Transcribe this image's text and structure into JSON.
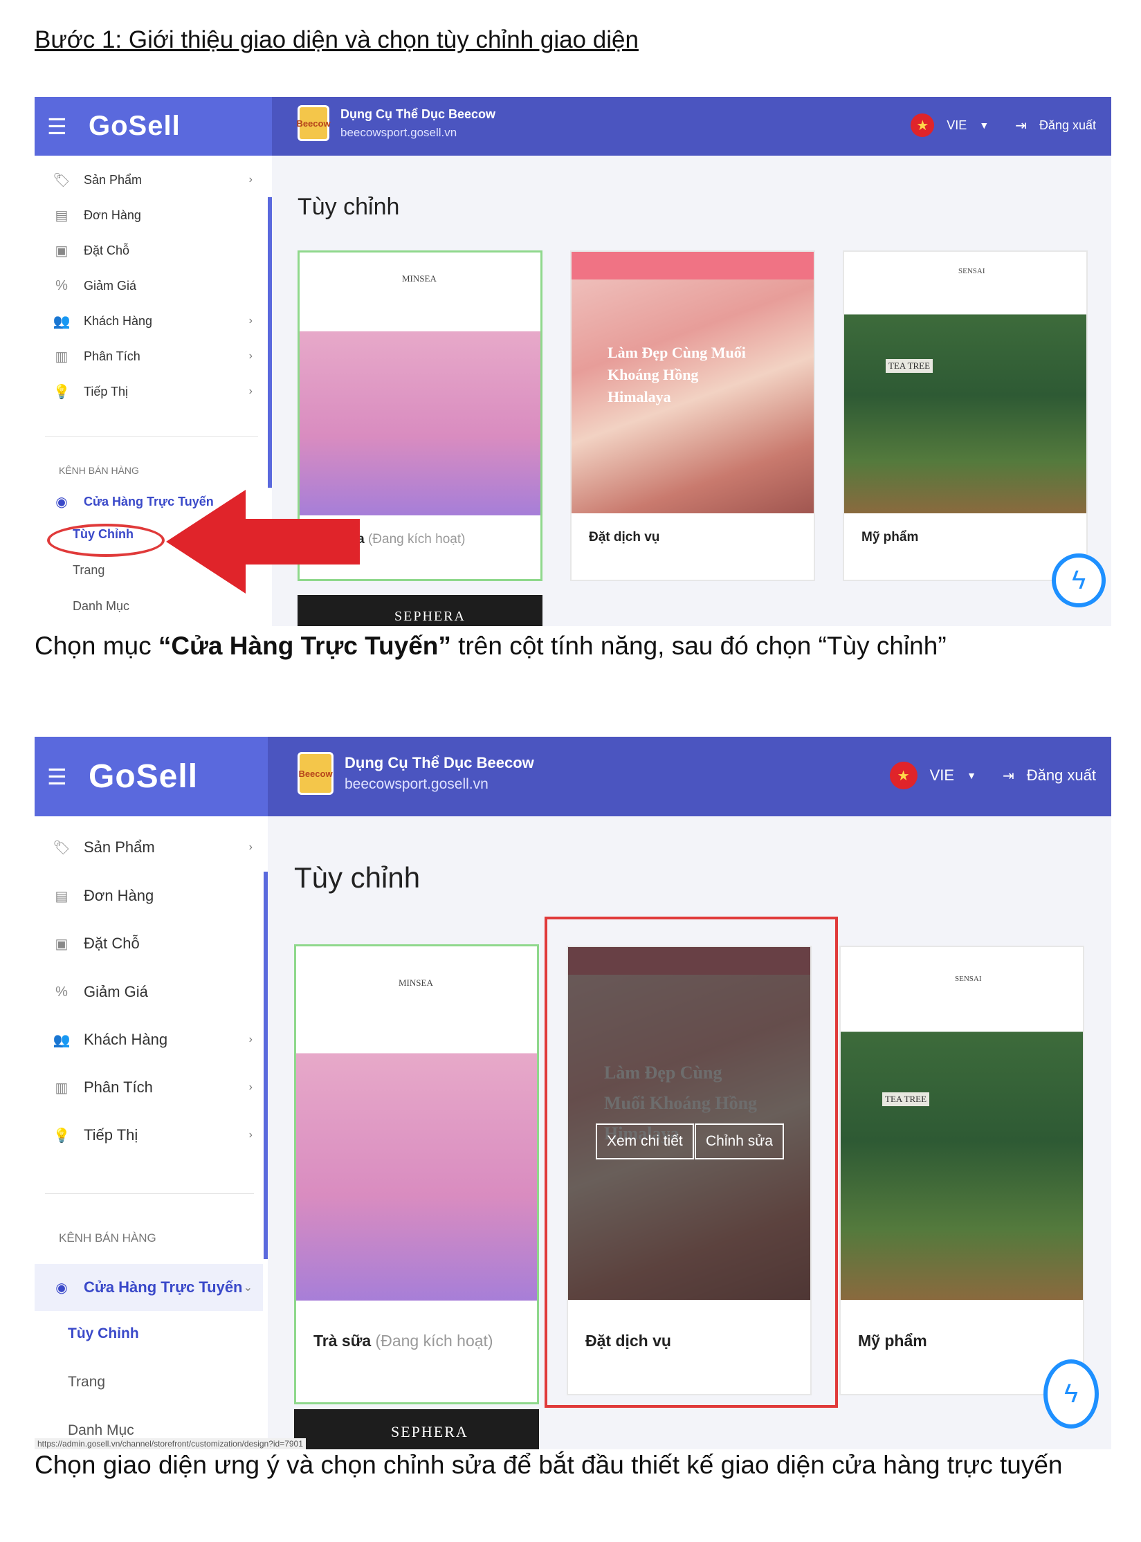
{
  "doc": {
    "heading": "Bước 1: Giới thiệu giao diện và chọn tùy chỉnh giao diện",
    "caption1_pre": "Chọn mục ",
    "caption1_bold": "“Cửa Hàng Trực Tuyến”",
    "caption1_post": " trên cột tính năng, sau đó chọn “Tùy chỉnh”",
    "caption2": "Chọn giao diện ưng ý và chọn chỉnh sửa để bắt đầu thiết kế giao diện cửa hàng trực tuyến"
  },
  "app": {
    "logo": "GoSell",
    "store_name": "Dụng Cụ Thể Dục Beecow",
    "store_url": "beecowsport.gosell.vn",
    "store_logo_text": "Beecow",
    "language": "VIE",
    "logout": "Đăng xuất",
    "page_title": "Tùy chỉnh"
  },
  "sidebar": {
    "items": [
      {
        "label": "Sản Phẩm",
        "icon": "tag-icon"
      },
      {
        "label": "Đơn Hàng",
        "icon": "receipt-icon"
      },
      {
        "label": "Đặt Chỗ",
        "icon": "calendar-icon"
      },
      {
        "label": "Giảm Giá",
        "icon": "discount-icon"
      },
      {
        "label": "Khách Hàng",
        "icon": "users-icon"
      },
      {
        "label": "Phân Tích",
        "icon": "chart-icon"
      },
      {
        "label": "Tiếp Thị",
        "icon": "bulb-icon"
      }
    ],
    "section": "KÊNH BÁN HÀNG",
    "online_store": "Cửa Hàng Trực Tuyến",
    "sub_items": [
      "Tùy Chỉnh",
      "Trang",
      "Danh Mục"
    ]
  },
  "themes": [
    {
      "label": "Trà sữa",
      "note": "(Đang kích hoạt)",
      "mini_title": "MINSEA"
    },
    {
      "label": "Đặt dịch vụ",
      "banner": "Làm Đẹp Cùng Muối Khoáng Hồng Himalaya"
    },
    {
      "label": "Mỹ phẩm",
      "mini_title": "SENSAI",
      "product_text": "TEA TREE"
    },
    {
      "label": "SEPHERA"
    }
  ],
  "overlay": {
    "view_details": "Xem chi tiết",
    "edit": "Chỉnh sửa"
  },
  "status_url": "https://admin.gosell.vn/channel/storefront/customization/design?id=7901",
  "colors": {
    "topbar": "#4b55c0",
    "logo_bg": "#5a69dd",
    "active_border": "#8fd88c",
    "highlight": "#e03a3a",
    "accent": "#3a49c9"
  }
}
